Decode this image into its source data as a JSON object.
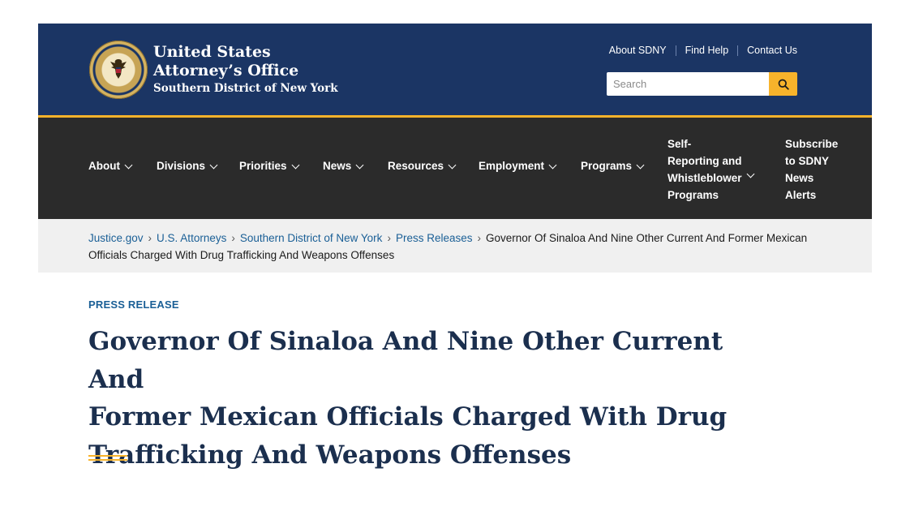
{
  "header": {
    "agency_line1": "United States",
    "agency_line2": "Attorney’s Office",
    "agency_line3": "Southern District of New York",
    "utility_links": [
      "About SDNY",
      "Find Help",
      "Contact Us"
    ],
    "search": {
      "placeholder": "Search"
    },
    "colors": {
      "header_bg": "#1b3564",
      "accent": "#f7b32b",
      "nav_bg": "#2b2b2b"
    }
  },
  "nav": {
    "items": [
      "About",
      "Divisions",
      "Priorities",
      "News",
      "Resources",
      "Employment",
      "Programs"
    ],
    "self_reporting": [
      "Self-",
      "Reporting and",
      "Whistleblower",
      "Programs"
    ],
    "subscribe": [
      "Subscribe",
      "to SDNY",
      "News",
      "Alerts"
    ]
  },
  "breadcrumb": {
    "links": [
      "Justice.gov",
      "U.S. Attorneys",
      "Southern District of New York",
      "Press Releases"
    ],
    "current": "Governor Of Sinaloa And Nine Other Current And Former Mexican Officials Charged With Drug Trafficking And Weapons Offenses"
  },
  "article": {
    "kicker": "PRESS RELEASE",
    "headline_lines": [
      "Governor Of Sinaloa And Nine Other Current And",
      "Former Mexican Officials Charged With Drug",
      "Trafficking And Weapons Offenses"
    ]
  }
}
